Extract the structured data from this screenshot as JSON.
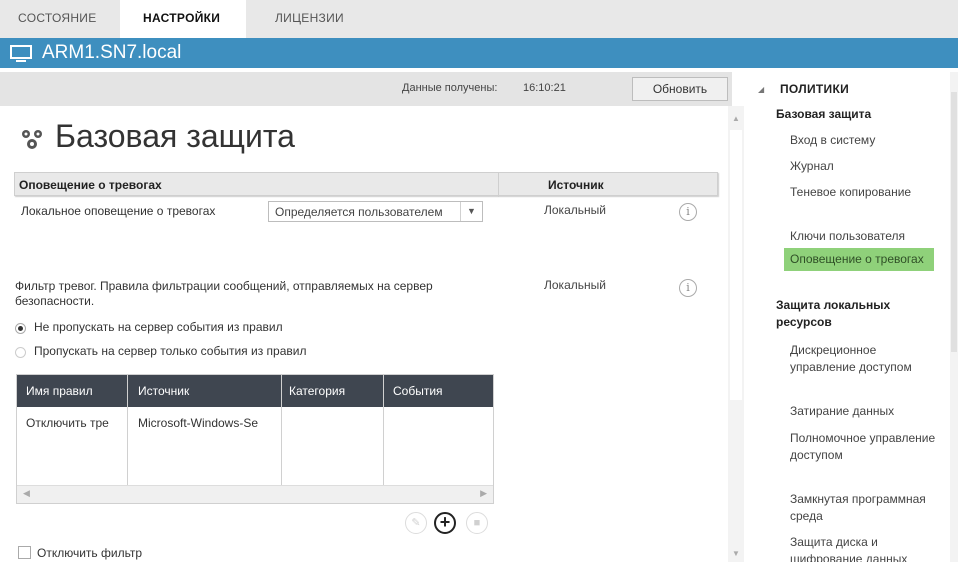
{
  "tabs": [
    {
      "label": "СОСТОЯНИЕ",
      "active": false
    },
    {
      "label": "НАСТРОЙКИ",
      "active": true
    },
    {
      "label": "ЛИЦЕНЗИИ",
      "active": false
    }
  ],
  "host": {
    "name": "ARM1.SN7.local",
    "icon": "computer-icon"
  },
  "infobar": {
    "received_label": "Данные получены:",
    "received_time": "16:10:21",
    "refresh_label": "Обновить"
  },
  "page": {
    "title": "Базовая защита",
    "icon": "shield-cog-icon"
  },
  "alerts_table": {
    "col_name": "Оповещение о тревогах",
    "col_source": "Источник",
    "row": {
      "label": "Локальное оповещение о тревогах",
      "select_value": "Определяется пользователем",
      "source": "Локальный"
    }
  },
  "filter": {
    "description": "Фильтр тревог. Правила фильтрации сообщений, отправляемых на сервер безопасности.",
    "desc_line1": "Фильтр тревог. Правила фильтрации сообщений, отправляемых на сервер",
    "desc_line2": "безопасности.",
    "source": "Локальный",
    "radio_1": "Не пропускать на сервер события из правил",
    "radio_2": "Пропускать на сервер только события из правил",
    "radio_selected": 1
  },
  "rules_table": {
    "columns": [
      "Имя правил",
      "Источник",
      "Категория",
      "События"
    ],
    "rows": [
      {
        "name": "Отключить тре",
        "source": "Microsoft-Windows-Se",
        "category": "",
        "events": ""
      }
    ]
  },
  "disable_filter_label": "Отключить фильтр",
  "policies": {
    "header": "ПОЛИТИКИ",
    "group1": "Базовая защита",
    "items1": [
      "Вход в систему",
      "Журнал",
      "Теневое копирование",
      "Ключи пользователя",
      "Оповещение о тревогах"
    ],
    "active_item": "Оповещение о тревогах",
    "group2": "Защита локальных ресурсов",
    "items2": [
      "Дискреционное управление доступом",
      "Затирание данных",
      "Полномочное управление доступом",
      "Замкнутая программная среда",
      "Защита диска и шифрование данных"
    ]
  },
  "colors": {
    "host_bar": "#3e8fbf",
    "active_policy": "#8fd17a",
    "rules_header": "#3f4650"
  }
}
